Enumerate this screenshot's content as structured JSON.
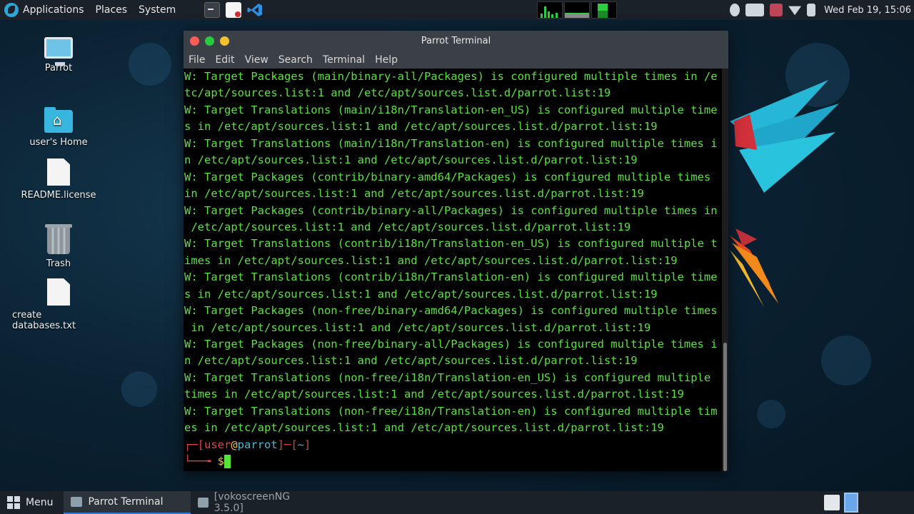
{
  "top_panel": {
    "menus": [
      "Applications",
      "Places",
      "System"
    ],
    "clock": "Wed Feb 19, 15:06"
  },
  "desktop": {
    "icons": [
      {
        "label": "Parrot",
        "icon": "computer-icon"
      },
      {
        "label": "user's Home",
        "icon": "home-folder-icon"
      },
      {
        "label": "README.license",
        "icon": "document-icon"
      },
      {
        "label": "Trash",
        "icon": "trash-icon"
      },
      {
        "label": "create databases.txt",
        "icon": "document-icon"
      }
    ]
  },
  "terminal": {
    "title": "Parrot Terminal",
    "menu": [
      "File",
      "Edit",
      "View",
      "Search",
      "Terminal",
      "Help"
    ],
    "lines": [
      "W: Target Packages (main/binary-all/Packages) is configured multiple times in /e",
      "tc/apt/sources.list:1 and /etc/apt/sources.list.d/parrot.list:19",
      "W: Target Translations (main/i18n/Translation-en_US) is configured multiple time",
      "s in /etc/apt/sources.list:1 and /etc/apt/sources.list.d/parrot.list:19",
      "W: Target Translations (main/i18n/Translation-en) is configured multiple times i",
      "n /etc/apt/sources.list:1 and /etc/apt/sources.list.d/parrot.list:19",
      "W: Target Packages (contrib/binary-amd64/Packages) is configured multiple times",
      "in /etc/apt/sources.list:1 and /etc/apt/sources.list.d/parrot.list:19",
      "W: Target Packages (contrib/binary-all/Packages) is configured multiple times in",
      " /etc/apt/sources.list:1 and /etc/apt/sources.list.d/parrot.list:19",
      "W: Target Translations (contrib/i18n/Translation-en_US) is configured multiple t",
      "imes in /etc/apt/sources.list:1 and /etc/apt/sources.list.d/parrot.list:19",
      "W: Target Translations (contrib/i18n/Translation-en) is configured multiple time",
      "s in /etc/apt/sources.list:1 and /etc/apt/sources.list.d/parrot.list:19",
      "W: Target Packages (non-free/binary-amd64/Packages) is configured multiple times",
      " in /etc/apt/sources.list:1 and /etc/apt/sources.list.d/parrot.list:19",
      "W: Target Packages (non-free/binary-all/Packages) is configured multiple times i",
      "n /etc/apt/sources.list:1 and /etc/apt/sources.list.d/parrot.list:19",
      "W: Target Translations (non-free/i18n/Translation-en_US) is configured multiple",
      "times in /etc/apt/sources.list:1 and /etc/apt/sources.list.d/parrot.list:19",
      "W: Target Translations (non-free/i18n/Translation-en) is configured multiple tim",
      "es in /etc/apt/sources.list:1 and /etc/apt/sources.list.d/parrot.list:19"
    ],
    "prompt": {
      "open": "┌─[",
      "user": "user",
      "at": "@",
      "host": "parrot",
      "mid": "]─[",
      "dir": "~",
      "close": "]",
      "second": "└──╼ ",
      "dollar": "$"
    }
  },
  "bottom_panel": {
    "menu_label": "Menu",
    "tasks": [
      "Parrot Terminal",
      "[vokoscreenNG 3.5.0]"
    ]
  },
  "colors": {
    "terminal_text": "#57e33b",
    "panel_bg": "#1b2128",
    "titlebar_bg": "#3b4046",
    "accent": "#2e7bd6"
  }
}
